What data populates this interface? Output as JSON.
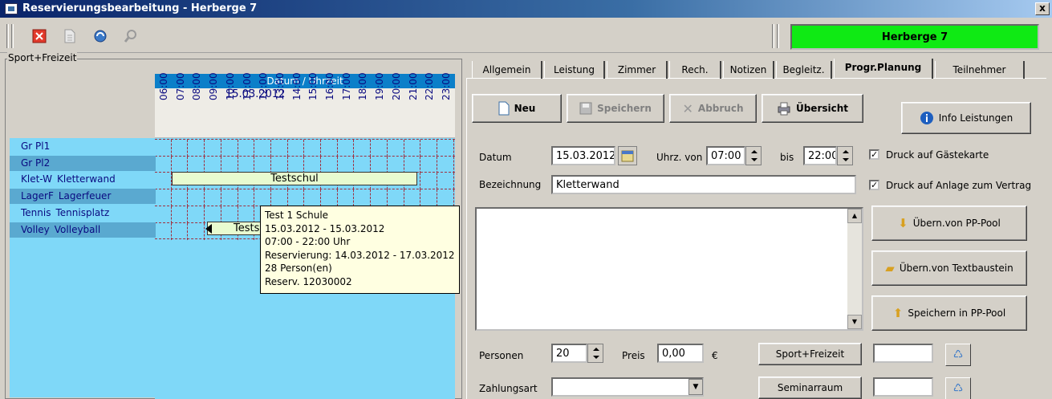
{
  "window": {
    "title": "Reservierungsbearbeitung - Herberge 7",
    "close": "x"
  },
  "toolbar": {
    "hostel_name": "Herberge 7",
    "icons": [
      "close-red-icon",
      "document-icon",
      "refresh-icon",
      "search-icon"
    ]
  },
  "left_group": {
    "label": "Sport+Freizeit",
    "header_title": "Datum / Uhrzeit",
    "date": "15.03.2012",
    "hours": [
      "06:00",
      "07:00",
      "08:00",
      "09:00",
      "10:00",
      "11:00",
      "12:00",
      "13:00",
      "14:00",
      "15:00",
      "16:00",
      "17:00",
      "18:00",
      "19:00",
      "20:00",
      "21:00",
      "22:00",
      "23:00"
    ],
    "rows": [
      {
        "code": "Gr Pl1",
        "name": ""
      },
      {
        "code": "Gr Pl2",
        "name": ""
      },
      {
        "code": "Klet-W",
        "name": "Kletterwand"
      },
      {
        "code": "LagerF",
        "name": "Lagerfeuer"
      },
      {
        "code": "Tennis",
        "name": "Tennisplatz"
      },
      {
        "code": "Volley",
        "name": "Volleyball"
      }
    ],
    "bookings": [
      {
        "label": "Testschul",
        "row": 2
      },
      {
        "label": "Testsc",
        "row": 5
      }
    ],
    "tooltip": [
      "Test 1 Schule",
      "15.03.2012 - 15.03.2012",
      "07:00 - 22:00 Uhr",
      "Reservierung: 14.03.2012 - 17.03.2012",
      "28 Person(en)",
      "Reserv. 12030002"
    ]
  },
  "tabs": [
    {
      "label": "Allgemein"
    },
    {
      "label": "Leistung"
    },
    {
      "label": "Zimmer"
    },
    {
      "label": "Rech."
    },
    {
      "label": "Notizen"
    },
    {
      "label": "Begleitz."
    },
    {
      "label": "Progr.Planung",
      "active": true
    },
    {
      "label": "Teilnehmer"
    }
  ],
  "actions": {
    "neu": "Neu",
    "speichern": "Speichern",
    "abbruch": "Abbruch",
    "uebersicht": "Übersicht",
    "info": "Info Leistungen"
  },
  "form": {
    "datum_label": "Datum",
    "datum": "15.03.2012",
    "uhrz_label": "Uhrz. von",
    "von": "07:00",
    "bis_label": "bis",
    "bis": "22:00",
    "druck_gaeste": "Druck auf Gästekarte",
    "druck_anlage": "Druck auf Anlage zum Vertrag",
    "bezeichnung_label": "Bezeichnung",
    "bezeichnung": "Kletterwand",
    "uebern_pp": "Übern.von PP-Pool",
    "uebern_text": "Übern.von Textbaustein",
    "speichern_pp": "Speichern in PP-Pool",
    "personen_label": "Personen",
    "personen": "20",
    "preis_label": "Preis",
    "preis": "0,00",
    "currency": "€",
    "sport_freizeit": "Sport+Freizeit",
    "zahlungsart_label": "Zahlungsart",
    "seminarraum": "Seminarraum"
  },
  "colors": {
    "hostel_bg": "#0fea14",
    "schedule_header": "#0b7fc9",
    "schedule_bg": "#7fd8f8",
    "booking": "#e8fbd0"
  }
}
